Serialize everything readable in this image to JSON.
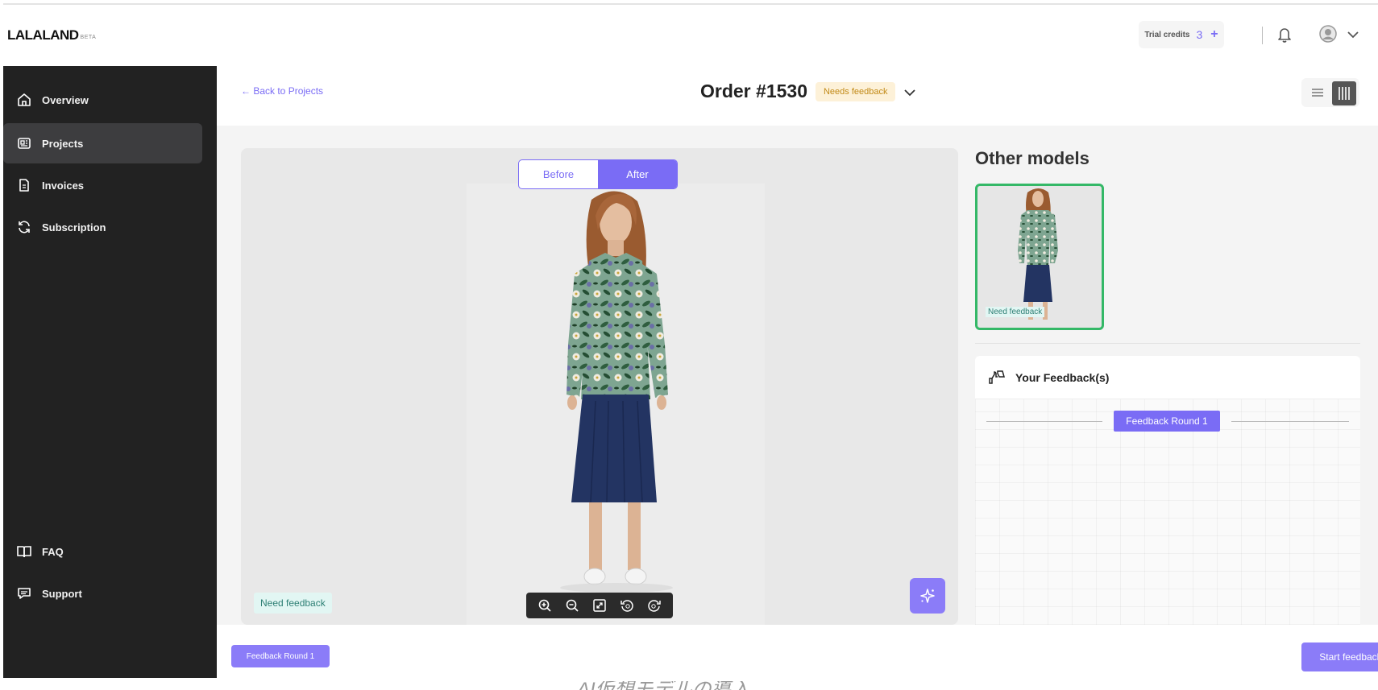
{
  "app": {
    "brand": "LALALAND",
    "beta": "BETA"
  },
  "sidebar": {
    "items": [
      {
        "label": "Overview",
        "icon": "home-icon"
      },
      {
        "label": "Projects",
        "icon": "projects-icon",
        "active": true
      },
      {
        "label": "Invoices",
        "icon": "invoice-icon"
      },
      {
        "label": "Subscription",
        "icon": "refresh-icon"
      }
    ],
    "bottom": [
      {
        "label": "FAQ",
        "icon": "book-icon"
      },
      {
        "label": "Support",
        "icon": "chat-icon"
      }
    ]
  },
  "header": {
    "trial_label": "Trial credits",
    "trial_count": "3",
    "trial_plus": "+"
  },
  "subheader": {
    "back": "← Back to Projects",
    "order_title": "Order #1530",
    "status": "Needs feedback"
  },
  "viewer": {
    "before": "Before",
    "after": "After",
    "need_feedback": "Need feedback"
  },
  "right_panel": {
    "title": "Other models",
    "thumb_label": "Need feedback",
    "feedback_title": "Your Feedback(s)",
    "round_chip": "Feedback Round 1"
  },
  "footer": {
    "round_button": "Feedback Round 1",
    "start_button": "Start feedback round"
  },
  "caption": "AI仮想モデルの導入",
  "colors": {
    "accent": "#7a6cf5",
    "sidebar_bg": "#222222",
    "status_bg": "#fdf1d8",
    "status_text": "#c28a17",
    "need_feedback_bg": "#e2f6f3",
    "thumb_border": "#34b867"
  }
}
